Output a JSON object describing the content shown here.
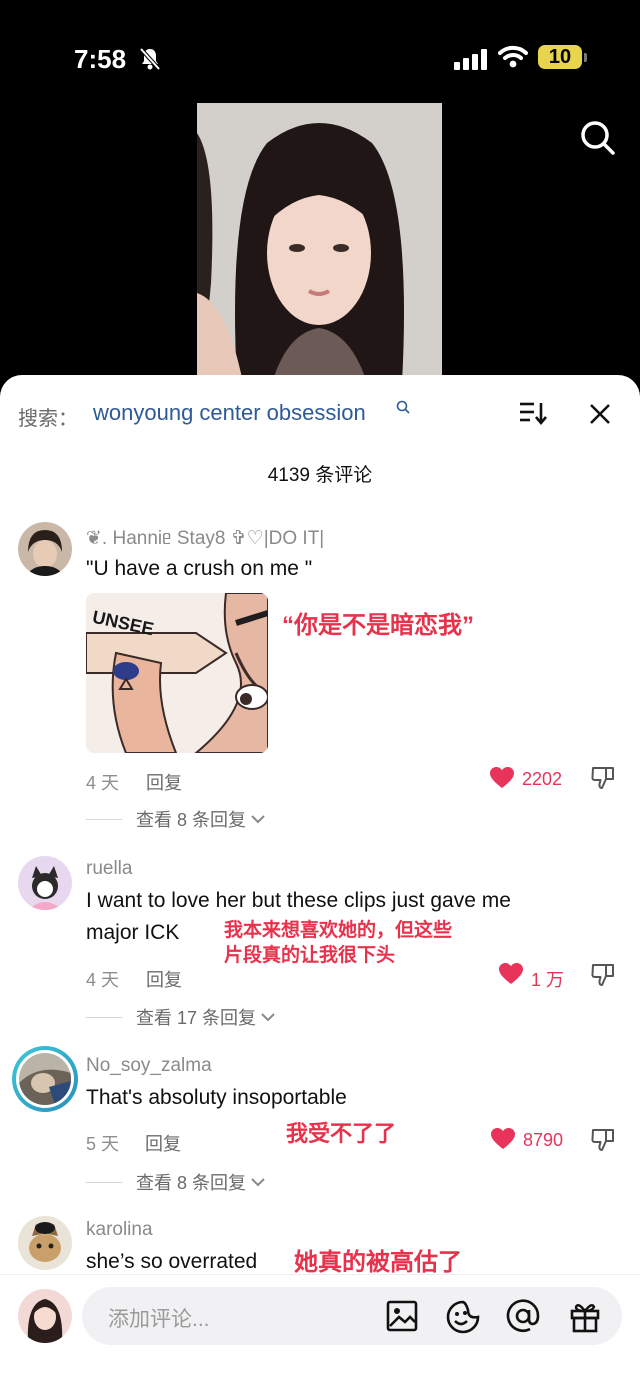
{
  "status_bar": {
    "time": "7:58",
    "battery": "10"
  },
  "search": {
    "prefix": "搜索：",
    "term": "wonyoung center obsession"
  },
  "comments_header": {
    "count_label": "4139 条评论"
  },
  "comments": [
    {
      "username": "❦. Hanniᥱ Stay8 ✞♡|DO IT|",
      "text": "\"U have a crush on me \"",
      "sticker_text": "UNSEE",
      "annotation": "“你是不是暗恋我”",
      "time": "4 天",
      "reply_label": "回复",
      "likes": "2202",
      "view_replies": "查看 8 条回复"
    },
    {
      "username": "ruella",
      "text_line1": "I want to love her but these clips just gave me",
      "text_line2": "major ICK",
      "annotation_line1": "我本来想喜欢她的，但这些",
      "annotation_line2": "片段真的让我很下头",
      "time": "4 天",
      "reply_label": "回复",
      "likes": "1 万",
      "view_replies": "查看 17 条回复"
    },
    {
      "username": "No_soy_zalma",
      "text": "That's absoluty insoportable",
      "annotation": "我受不了了",
      "time": "5 天",
      "reply_label": "回复",
      "likes": "8790",
      "view_replies": "查看 8 条回复"
    },
    {
      "username": "karolina",
      "text": "she’s so overrated",
      "annotation": "她真的被高估了"
    }
  ],
  "input": {
    "placeholder": "添加评论..."
  },
  "colors": {
    "like_red": "#e8335a",
    "search_blue": "#2e5a97",
    "annotation_red": "#e8324c"
  }
}
